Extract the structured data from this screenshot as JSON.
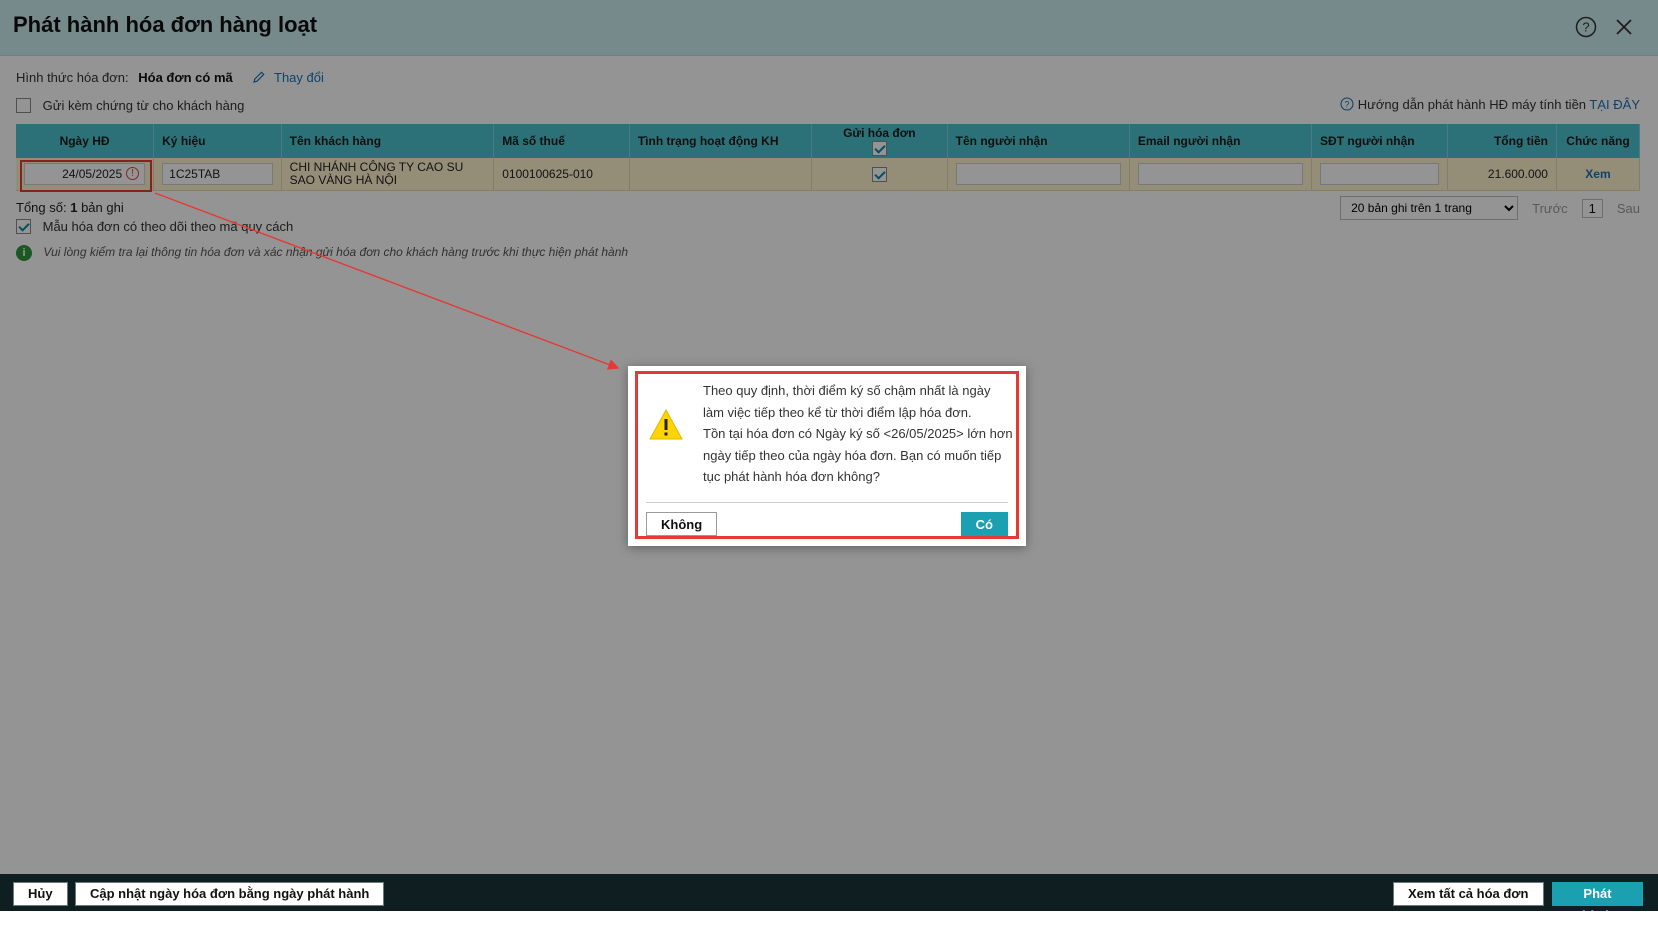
{
  "window": {
    "title": "Phát hành hóa đơn hàng loạt"
  },
  "form": {
    "invoice_type_label": "Hình thức hóa đơn:",
    "invoice_type_value": "Hóa đơn có mã",
    "change_link": "Thay đổi",
    "attach_docs_label": "Gửi kèm chứng từ cho khách hàng",
    "guide_text": "Hướng dẫn phát hành HĐ máy tính tiền",
    "guide_link": "TẠI ĐÂY"
  },
  "table": {
    "headers": {
      "date": "Ngày HĐ",
      "symbol": "Ký hiệu",
      "customer": "Tên khách hàng",
      "tax_code": "Mã số thuế",
      "status": "Tình trạng hoạt động KH",
      "send": "Gửi hóa đơn",
      "recipient_name": "Tên người nhận",
      "recipient_email": "Email người nhận",
      "recipient_phone": "SĐT người nhận",
      "total": "Tổng tiền",
      "action": "Chức năng"
    },
    "rows": [
      {
        "date": "24/05/2025",
        "symbol": "1C25TAB",
        "customer": "CHI NHÁNH CÔNG TY CAO SU SAO VÀNG HÀ NỘI",
        "tax_code": "0100100625-010",
        "status": "",
        "send": true,
        "total": "21.600.000",
        "action": "Xem"
      }
    ]
  },
  "summary": {
    "label": "Tổng số:",
    "count": "1",
    "suffix": "bản ghi"
  },
  "pager": {
    "page_size": "20 bản ghi trên 1 trang",
    "prev": "Trước",
    "page": "1",
    "next": "Sau"
  },
  "options": {
    "track_spec_label": "Mẫu hóa đơn có theo dõi theo mã quy cách",
    "note": "Vui lòng kiểm tra lại thông tin hóa đơn và xác nhận gửi hóa đơn cho khách hàng trước khi thực hiện phát hành"
  },
  "dialog": {
    "line1": "Theo quy định, thời điểm ký số chậm nhất là ngày làm việc tiếp theo kể từ thời điểm lập hóa đơn.",
    "line2": "Tồn tại hóa đơn có Ngày ký số <26/05/2025> lớn hơn ngày tiếp theo của ngày hóa đơn. Bạn có muốn tiếp tục phát hành hóa đơn không?",
    "no_label": "Không",
    "yes_label": "Có"
  },
  "footer": {
    "cancel": "Hủy",
    "update_date": "Cập nhật ngày hóa đơn bằng ngày phát hành",
    "view_all": "Xem tất cả hóa đơn",
    "publish": "Phát hành"
  },
  "colors": {
    "header_bg": "#cdeef0",
    "table_header": "#4fc3cf",
    "row_highlight": "#fff3cd",
    "accent": "#1aa0b1",
    "alert_red": "#e53935"
  }
}
